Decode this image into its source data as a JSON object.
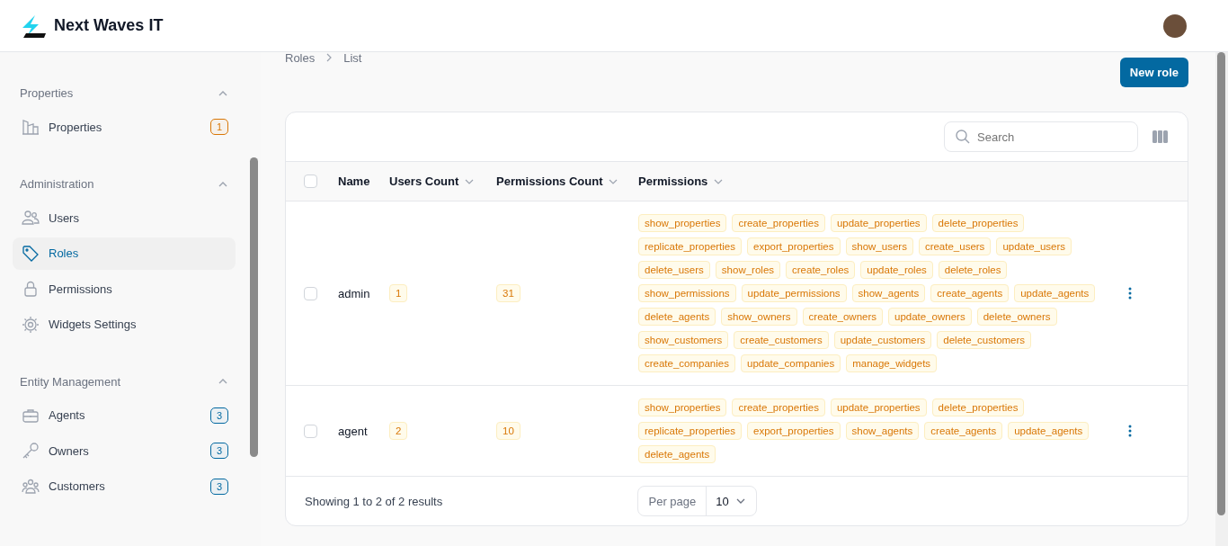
{
  "header": {
    "brand": "Next Waves IT"
  },
  "sidebar": {
    "groups": [
      {
        "title": "Properties",
        "expanded": true,
        "items": [
          {
            "label": "Properties",
            "selected": false,
            "badge": "1",
            "color": "#d97706"
          }
        ]
      },
      {
        "title": "Administration",
        "expanded": true,
        "items": [
          {
            "label": "Users",
            "selected": false
          },
          {
            "label": "Roles",
            "selected": true
          },
          {
            "label": "Permissions",
            "selected": false
          },
          {
            "label": "Widgets Settings",
            "selected": false
          }
        ]
      },
      {
        "title": "Entity Management",
        "expanded": true,
        "items": [
          {
            "label": "Agents",
            "selected": false,
            "badge": "3",
            "color": "#0369a1"
          },
          {
            "label": "Owners",
            "selected": false,
            "badge": "3",
            "color": "#0369a1"
          },
          {
            "label": "Customers",
            "selected": false,
            "badge": "3",
            "color": "#0369a1"
          }
        ]
      }
    ]
  },
  "breadcrumbs": [
    "Roles",
    "List"
  ],
  "new_button": "New role",
  "search": {
    "placeholder": "Search"
  },
  "table": {
    "select_all_checked": false,
    "columns": [
      {
        "label": "Name",
        "sortable": false
      },
      {
        "label": "Users Count",
        "sortable": true
      },
      {
        "label": "Permissions Count",
        "sortable": true
      },
      {
        "label": "Permissions",
        "sortable": true
      }
    ],
    "rows": [
      {
        "checked": false,
        "name": "admin",
        "users_count": "1",
        "permissions_count": "31",
        "permissions": [
          "show_properties",
          "create_properties",
          "update_properties",
          "delete_properties",
          "replicate_properties",
          "export_properties",
          "show_users",
          "create_users",
          "update_users",
          "delete_users",
          "show_roles",
          "create_roles",
          "update_roles",
          "delete_roles",
          "show_permissions",
          "update_permissions",
          "show_agents",
          "create_agents",
          "update_agents",
          "delete_agents",
          "show_owners",
          "create_owners",
          "update_owners",
          "delete_owners",
          "show_customers",
          "create_customers",
          "update_customers",
          "delete_customers",
          "create_companies",
          "update_companies",
          "manage_widgets"
        ]
      },
      {
        "checked": false,
        "name": "agent",
        "users_count": "2",
        "permissions_count": "10",
        "permissions": [
          "show_properties",
          "create_properties",
          "update_properties",
          "delete_properties",
          "replicate_properties",
          "export_properties",
          "show_agents",
          "create_agents",
          "update_agents",
          "delete_agents"
        ]
      }
    ]
  },
  "footer": {
    "summary": "Showing 1 to 2 of 2 results",
    "per_page_label": "Per page",
    "per_page_value": "10"
  }
}
